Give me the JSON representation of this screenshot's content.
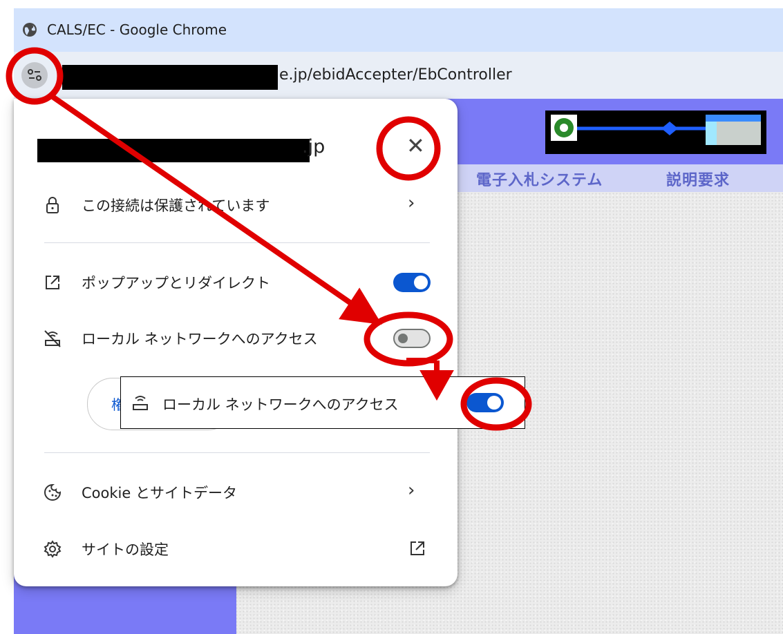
{
  "window": {
    "title": "CALS/EC - Google Chrome"
  },
  "address_bar": {
    "url_visible": "e.jp/ebidAccepter/EbController",
    "site_icon": "tune-icon"
  },
  "page": {
    "nav_items": [
      "電子入札システム",
      "説明要求"
    ]
  },
  "popup": {
    "site_suffix": ".jp",
    "close_icon": "close-icon",
    "connection": {
      "label": "この接続は保護されています",
      "icon": "lock-icon"
    },
    "permissions": [
      {
        "label": "ポップアップとリダイレクト",
        "icon": "open-in-new-icon",
        "enabled": true
      },
      {
        "label": "ローカル ネットワークへのアクセス",
        "icon": "router-off-icon",
        "enabled": false
      }
    ],
    "reset_button_partial": "権",
    "cookie": {
      "label": "Cookie とサイトデータ",
      "icon": "cookie-icon"
    },
    "site_settings": {
      "label": "サイトの設定",
      "icon": "gear-icon"
    }
  },
  "callout": {
    "label": "ローカル ネットワークへのアクセス",
    "icon": "router-icon",
    "enabled": true
  },
  "colors": {
    "toggle_on": "#0b57d0",
    "annotation_red": "#e00000",
    "page_header": "#7a7af6"
  }
}
